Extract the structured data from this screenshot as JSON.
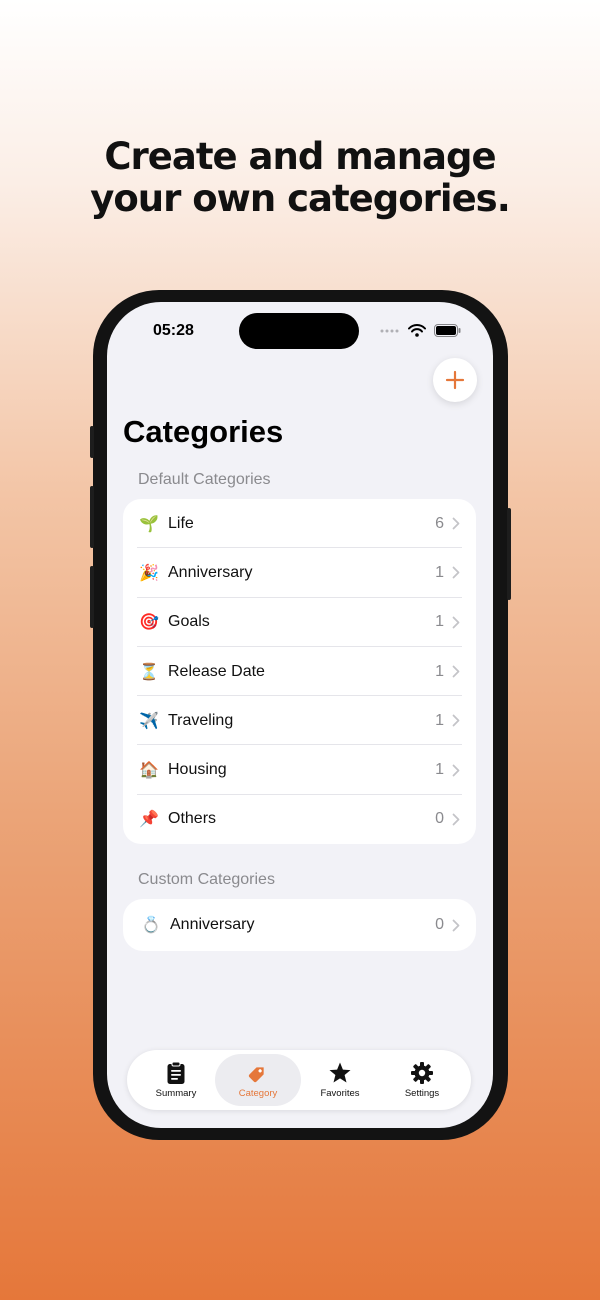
{
  "headline": {
    "line1": "Create and manage",
    "line2": "your own categories."
  },
  "status_bar": {
    "time": "05:28",
    "icons": [
      "signal-dots-icon",
      "wifi-icon",
      "battery-icon"
    ]
  },
  "header": {
    "title": "Categories",
    "add_icon": "plus-icon"
  },
  "default_section": {
    "label": "Default Categories",
    "items": [
      {
        "emoji": "🌱",
        "label": "Life",
        "count": "6"
      },
      {
        "emoji": "🎉",
        "label": "Anniversary",
        "count": "1"
      },
      {
        "emoji": "🎯",
        "label": "Goals",
        "count": "1"
      },
      {
        "emoji": "⏳",
        "label": "Release Date",
        "count": "1"
      },
      {
        "emoji": "✈️",
        "label": "Traveling",
        "count": "1"
      },
      {
        "emoji": "🏠",
        "label": "Housing",
        "count": "1"
      },
      {
        "emoji": "📌",
        "label": "Others",
        "count": "0"
      }
    ]
  },
  "custom_section": {
    "label": "Custom Categories",
    "items": [
      {
        "emoji": "💍",
        "label": "Anniversary",
        "count": "0"
      }
    ]
  },
  "tabbar": {
    "tabs": [
      {
        "label": "Summary",
        "icon": "clipboard-icon"
      },
      {
        "label": "Category",
        "icon": "tag-icon",
        "active": true
      },
      {
        "label": "Favorites",
        "icon": "star-icon"
      },
      {
        "label": "Settings",
        "icon": "gear-icon"
      }
    ]
  },
  "colors": {
    "accent": "#e5773a",
    "background_gradient_end": "#e5773a",
    "screen_bg": "#f2f2f7"
  }
}
